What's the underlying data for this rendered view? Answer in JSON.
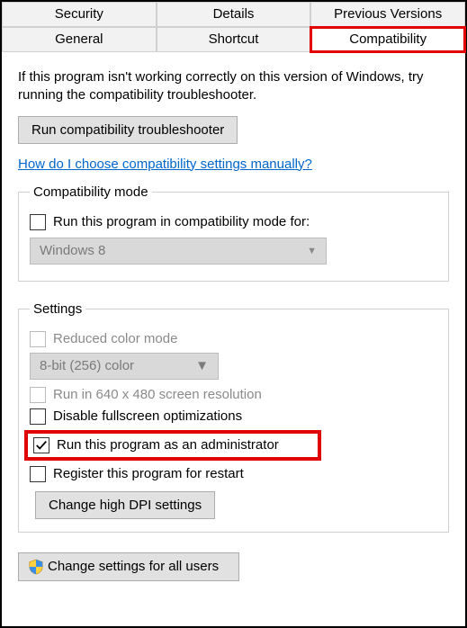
{
  "tabs": {
    "row1": [
      "Security",
      "Details",
      "Previous Versions"
    ],
    "row2": [
      "General",
      "Shortcut",
      "Compatibility"
    ]
  },
  "intro": "If this program isn't working correctly on this version of Windows, try running the compatibility troubleshooter.",
  "troubleshoot_btn": "Run compatibility troubleshooter",
  "link": "How do I choose compatibility settings manually?",
  "compat_mode": {
    "legend": "Compatibility mode",
    "checkbox": "Run this program in compatibility mode for:",
    "select": "Windows 8"
  },
  "settings": {
    "legend": "Settings",
    "reduced_color": "Reduced color mode",
    "color_select": "8-bit (256) color",
    "run640": "Run in 640 x 480 screen resolution",
    "disable_fullscreen": "Disable fullscreen optimizations",
    "run_admin": "Run this program as an administrator",
    "register_restart": "Register this program for restart",
    "dpi_btn": "Change high DPI settings"
  },
  "all_users_btn": "Change settings for all users"
}
